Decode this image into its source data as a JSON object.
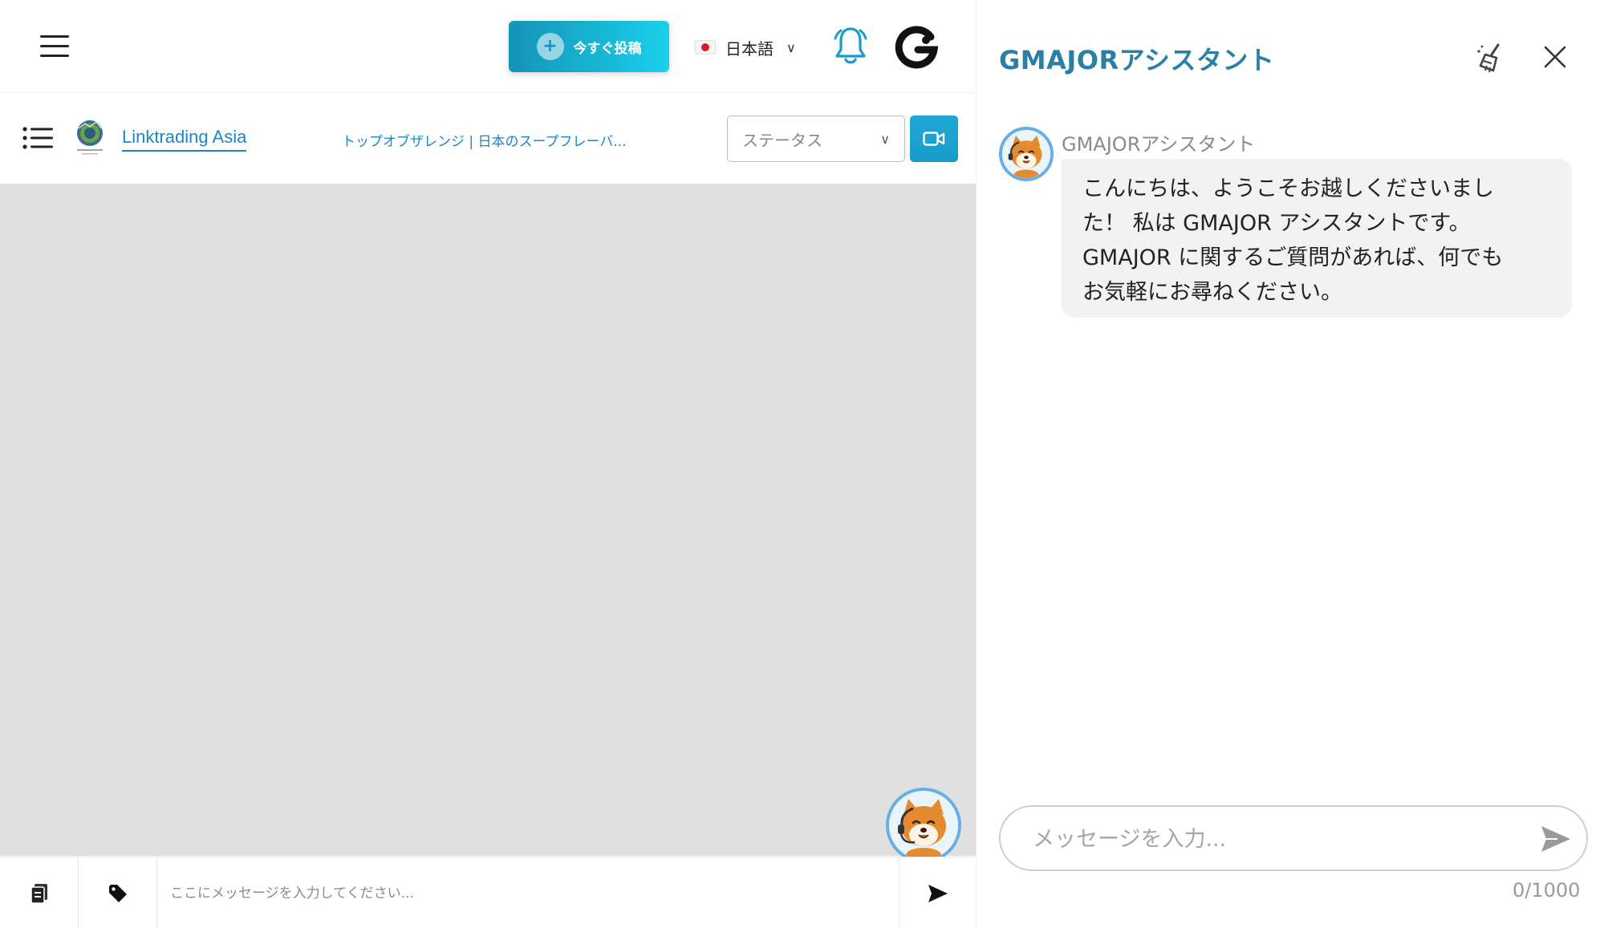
{
  "topbar": {
    "post_label": "今すぐ投稿",
    "language": "日本語"
  },
  "subbar": {
    "shop_name": "Linktrading Asia",
    "product_title": "トップオブザレンジ | 日本のスープフレーバ...",
    "status_placeholder": "ステータス"
  },
  "composer": {
    "placeholder": "ここにメッセージを入力してください..."
  },
  "assistant": {
    "title": "GMAJORアシスタント",
    "bot_name": "GMAJORアシスタント",
    "message_line1": "こんにちは、ようこそお越しくださいまし",
    "message_line2": "た！ 私は GMAJOR アシスタントです。",
    "message_line3": "GMAJOR に関するご質問があれば、何でも",
    "message_line4": "お気軽にお尋ねください。",
    "input_placeholder": "メッセージを入力...",
    "counter": "0/1000"
  },
  "colors": {
    "accent": "#1a86c9",
    "title": "#2a7fa6",
    "post_gradient_start": "#1593b8",
    "post_gradient_end": "#19d0ec",
    "chat_bg": "#e0e0e0"
  },
  "icons": {
    "menu": "hamburger-icon",
    "post": "plus-circle-icon",
    "flag": "japan-flag-icon",
    "notifications": "bell-icon",
    "brand": "g-logo-icon",
    "list": "list-icon",
    "video": "video-camera-icon",
    "copy": "clipboard-icon",
    "tag": "tag-icon",
    "send": "send-icon",
    "clear": "broom-icon",
    "close": "close-icon",
    "mascot": "shiba-mascot-icon"
  }
}
